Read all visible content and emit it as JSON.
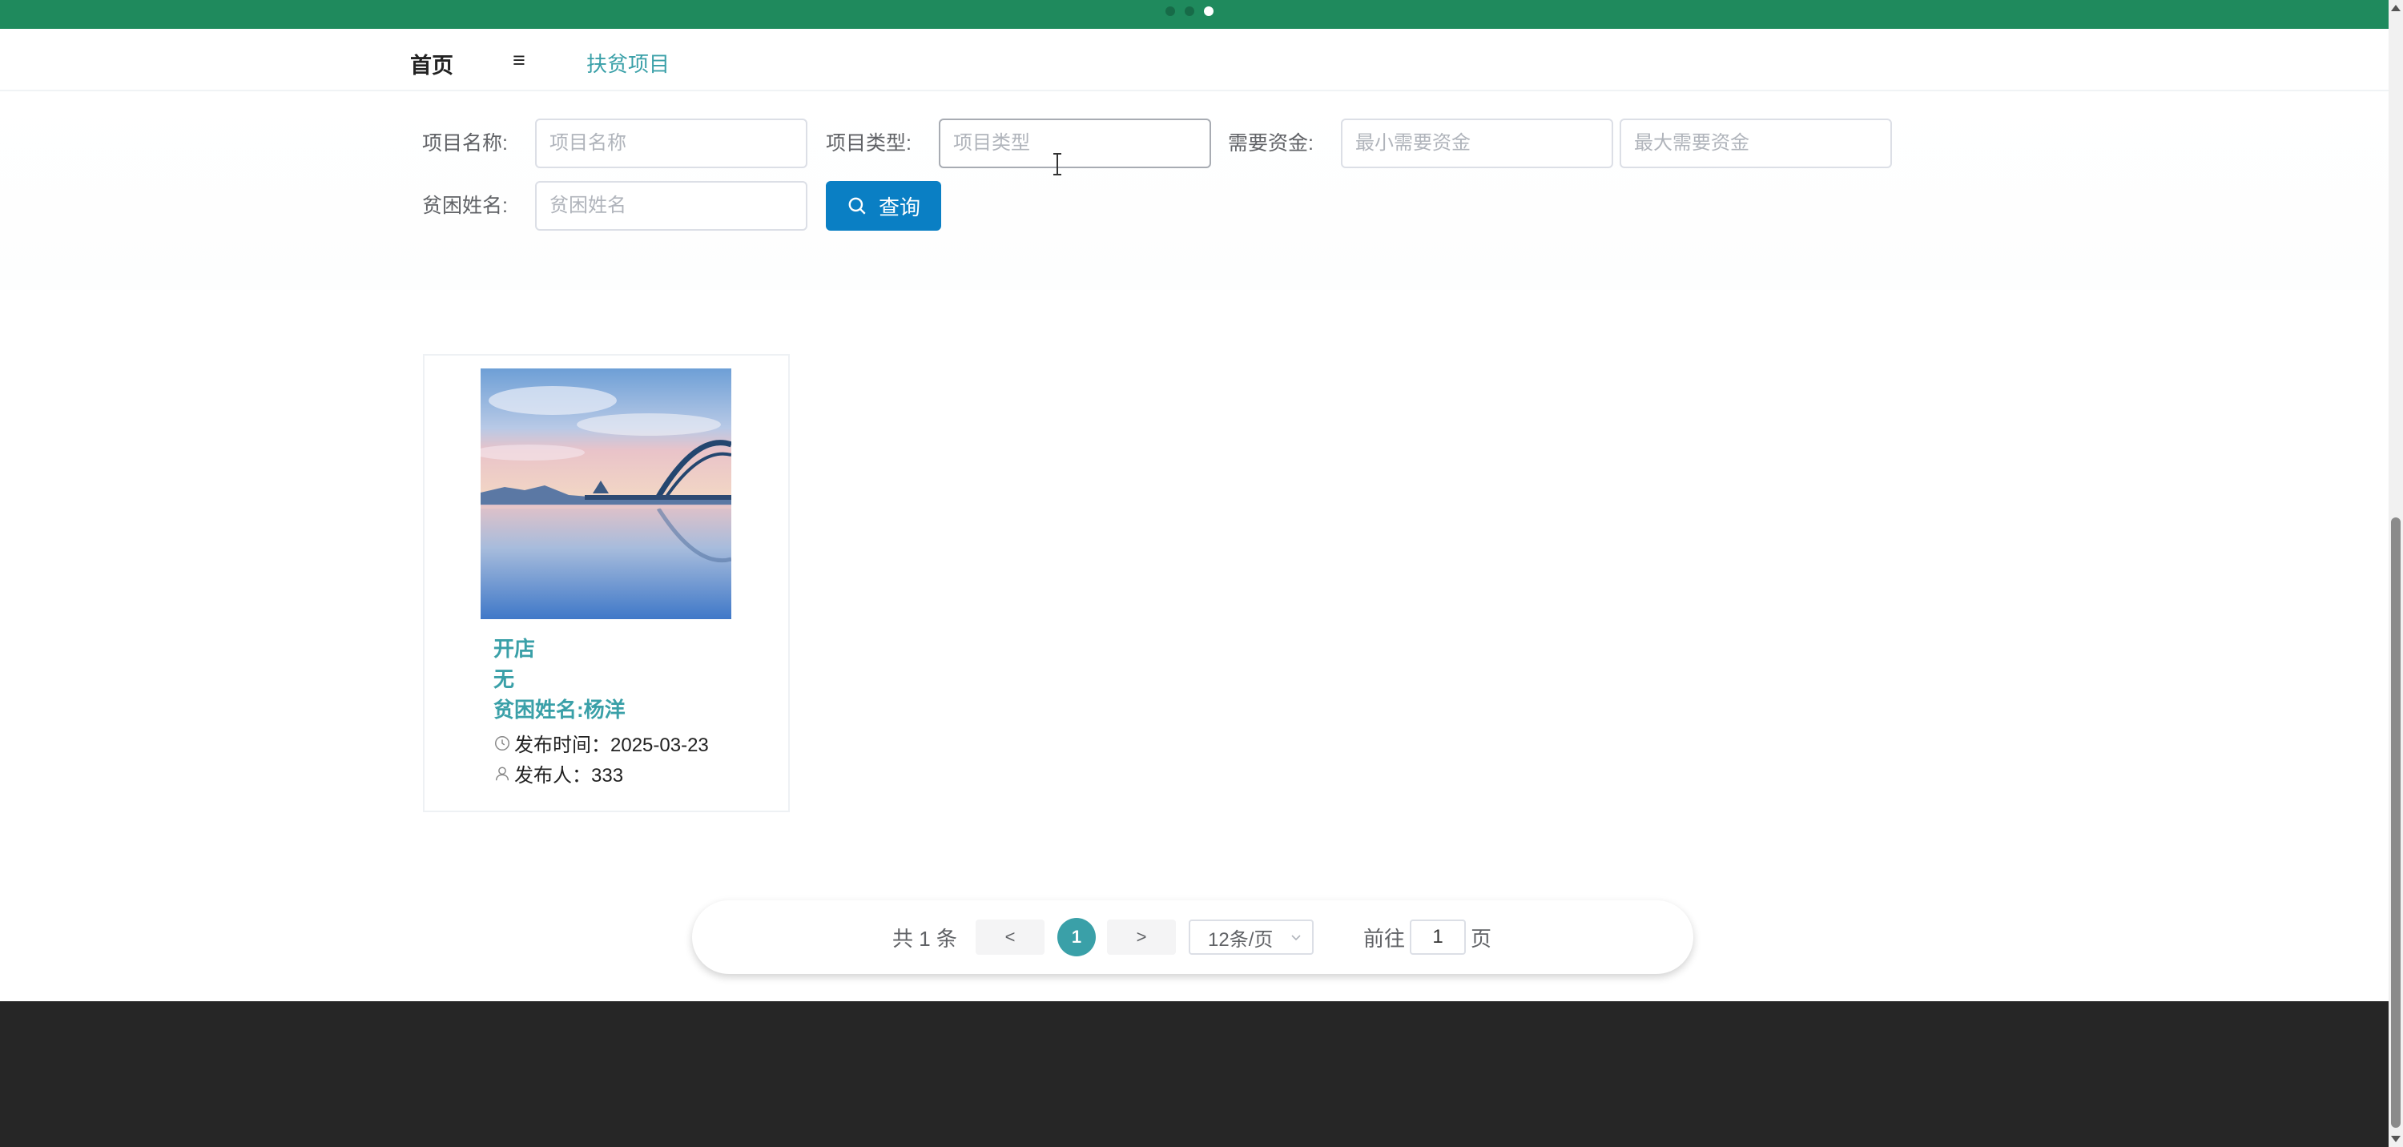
{
  "nav": {
    "home": "首页",
    "separator": "≡",
    "current": "扶贫项目"
  },
  "search": {
    "project_name_label": "项目名称:",
    "project_name_placeholder": "项目名称",
    "project_type_label": "项目类型:",
    "project_type_placeholder": "项目类型",
    "funding_label": "需要资金:",
    "min_funding_placeholder": "最小需要资金",
    "max_funding_placeholder": "最大需要资金",
    "poor_name_label": "贫困姓名:",
    "poor_name_placeholder": "贫困姓名",
    "search_button": "查询"
  },
  "cards": [
    {
      "title": "开店",
      "description": "无",
      "poor_name": "贫困姓名:杨洋",
      "publish_time": "发布时间：2025-03-23",
      "publisher": "发布人：333"
    }
  ],
  "pagination": {
    "total": "共 1 条",
    "prev": "<",
    "current_page": "1",
    "next": ">",
    "page_size": "12条/页",
    "goto_label": "前往",
    "goto_value": "1",
    "page_word": "页"
  },
  "colors": {
    "banner": "#1f8a5d",
    "accent": "#3aa0a8",
    "button": "#0a7fc4",
    "footer": "#262626"
  }
}
